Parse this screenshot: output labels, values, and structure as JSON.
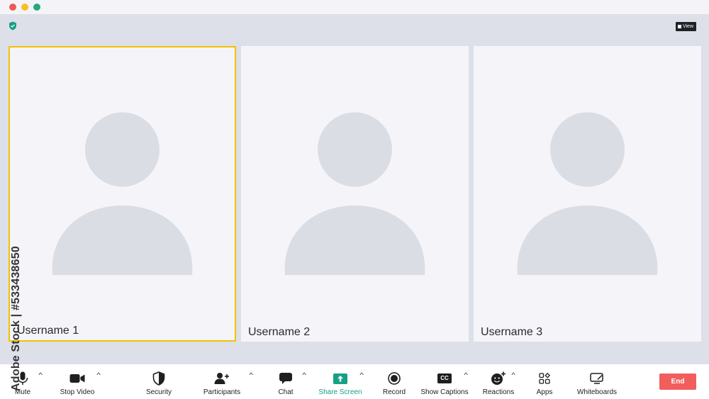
{
  "window": {
    "traffic_lights": [
      "#ee5a52",
      "#f4bf2b",
      "#26a87a"
    ]
  },
  "header": {
    "view_label": "View"
  },
  "participants": [
    {
      "username": "Username 1",
      "active": true
    },
    {
      "username": "Username 2",
      "active": false
    },
    {
      "username": "Username 3",
      "active": false
    }
  ],
  "toolbar": {
    "mute": "Mute",
    "stop_video": "Stop Video",
    "security": "Security",
    "participants": "Participants",
    "chat": "Chat",
    "share_screen": "Share Screen",
    "record": "Record",
    "show_captions": "Show Captions",
    "cc_badge": "CC",
    "reactions": "Reactions",
    "apps": "Apps",
    "whiteboards": "Whiteboards",
    "end": "End",
    "caret": "^"
  },
  "watermark": {
    "stock_id": "Adobe Stock | #533438650"
  },
  "colors": {
    "active_border": "#f2c200",
    "share_green": "#16a085",
    "end_red": "#f25d5d",
    "stage_bg": "#dde0e8",
    "tile_bg": "#f5f5f9",
    "avatar": "#dadde4"
  }
}
